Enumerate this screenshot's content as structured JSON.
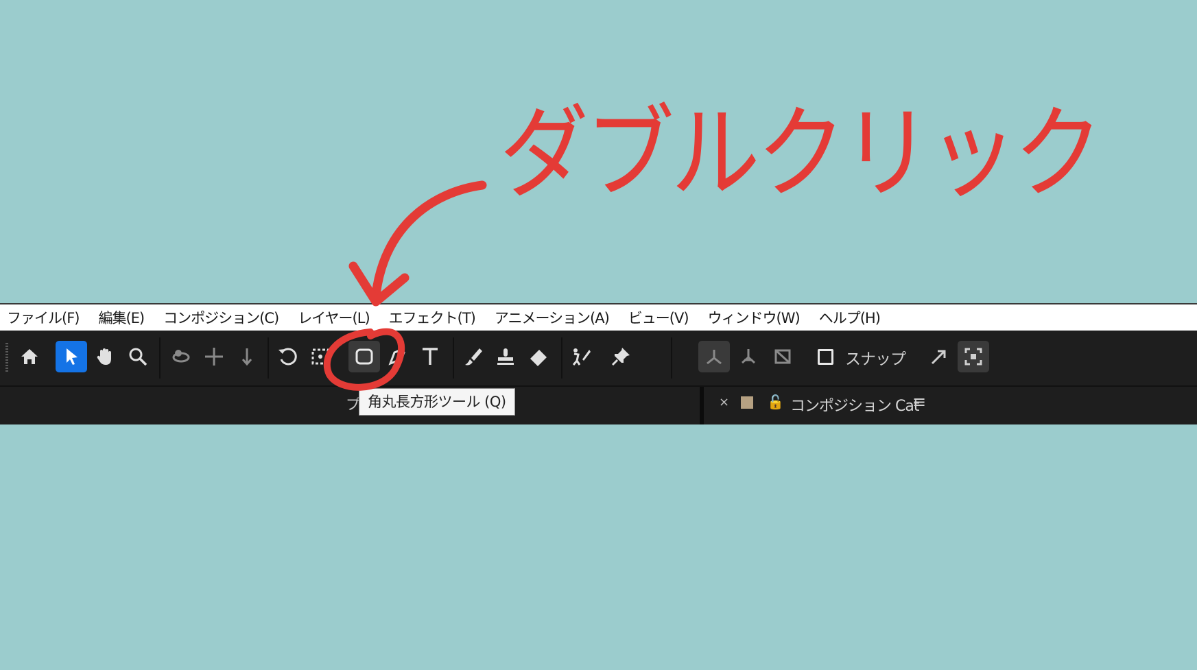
{
  "annotation": {
    "text": "ダブルクリック",
    "color": "#e43b36"
  },
  "menubar": {
    "items": [
      "ファイル(F)",
      "編集(E)",
      "コンポジション(C)",
      "レイヤー(L)",
      "エフェクト(T)",
      "アニメーション(A)",
      "ビュー(V)",
      "ウィンドウ(W)",
      "ヘルプ(H)"
    ]
  },
  "toolbar": {
    "tools": [
      "home",
      "selection",
      "hand",
      "zoom",
      "orbit",
      "pan",
      "dolly",
      "rotate",
      "anchor",
      "rounded-rectangle",
      "pen",
      "text",
      "brush",
      "clone-stamp",
      "eraser",
      "roto-brush",
      "puppet-pin"
    ],
    "active_tool": "selection",
    "highlighted_tool": "rounded-rectangle",
    "snap_label": "スナップ"
  },
  "panel": {
    "left_tab_fragment": "プ",
    "tooltip": "角丸長方形ツール (Q)",
    "comp_tab": {
      "close": "×",
      "title": "コンポジション Cat",
      "swatch_color": "#b6a182",
      "menu": "≡"
    }
  },
  "colors": {
    "background": "#9bcccd",
    "accent": "#1473e6",
    "annotation": "#e43b36"
  }
}
